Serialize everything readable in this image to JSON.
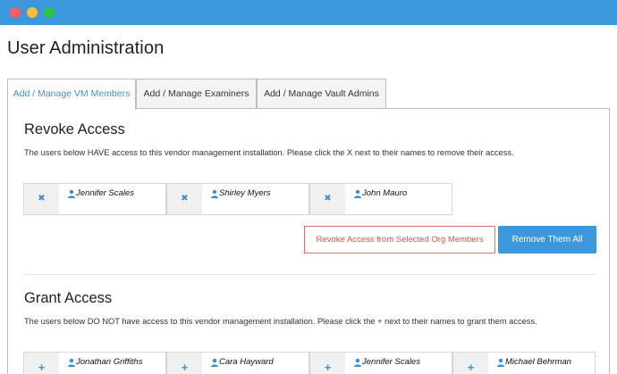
{
  "window": {
    "controls": [
      "close",
      "minimize",
      "maximize"
    ]
  },
  "page": {
    "title": "User Administration"
  },
  "tabs": [
    {
      "label": "Add / Manage VM Members",
      "active": true
    },
    {
      "label": "Add / Manage Examiners",
      "active": false
    },
    {
      "label": "Add / Manage Vault Admins",
      "active": false
    }
  ],
  "revoke": {
    "title": "Revoke Access",
    "description": "The users below HAVE access to this vendor management installation. Please click the X next to their names to remove their access.",
    "action_glyph": "✖",
    "members": [
      "Jennifer Scales",
      "Shirley Myers",
      "John Mauro"
    ],
    "revoke_selected_label": "Revoke Access from Selected Org Members",
    "remove_all_label": "Remove Them All"
  },
  "grant": {
    "title": "Grant Access",
    "description": "The users below DO NOT have access to this vendor management installation. Please click the + next to their names to grant them access.",
    "action_glyph": "+",
    "members": [
      "Jonathan Griffiths",
      "Cara Hayward",
      "Jennifer Scales",
      "Michael Behrman"
    ]
  },
  "icons": {
    "person": "person-icon",
    "remove": "remove-x-icon",
    "add": "add-plus-icon"
  },
  "colors": {
    "accent": "#3d97dc",
    "danger": "#d9534f",
    "titlebar": "#3d97dc"
  }
}
